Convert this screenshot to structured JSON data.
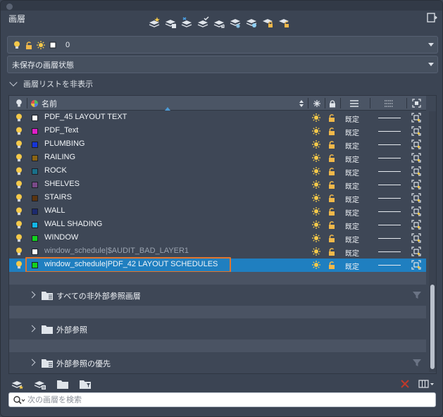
{
  "panel": {
    "title": "画層"
  },
  "top_toolbar": {
    "icons": [
      "new-layer-icon",
      "new-vp-freeze-layer-icon",
      "delete-layer-icon",
      "set-current-icon",
      "layer-states-icon",
      "freeze-vp-icon",
      "isolate-icon",
      "lock-icon",
      "unlock-icon"
    ]
  },
  "current_layer": {
    "value": "0"
  },
  "layer_state": {
    "value": "未保存の画層状態"
  },
  "collapse": {
    "label": "画層リストを非表示"
  },
  "list": {
    "columns": {
      "name": "名前"
    },
    "rows": [
      {
        "name": "PDF_45 LAYOUT TEXT",
        "color": "#ffffff",
        "linetype": "既定",
        "dim": false,
        "selected": false
      },
      {
        "name": "PDF_Text",
        "color": "#e01ec8",
        "linetype": "既定",
        "dim": false,
        "selected": false
      },
      {
        "name": "PLUMBING",
        "color": "#1634d8",
        "linetype": "既定",
        "dim": false,
        "selected": false
      },
      {
        "name": "RAILING",
        "color": "#8a6414",
        "linetype": "既定",
        "dim": false,
        "selected": false
      },
      {
        "name": "ROCK",
        "color": "#19708a",
        "linetype": "既定",
        "dim": false,
        "selected": false
      },
      {
        "name": "SHELVES",
        "color": "#7a4a88",
        "linetype": "既定",
        "dim": false,
        "selected": false
      },
      {
        "name": "STAIRS",
        "color": "#5a3410",
        "linetype": "既定",
        "dim": false,
        "selected": false
      },
      {
        "name": "WALL",
        "color": "#1c2a6e",
        "linetype": "既定",
        "dim": false,
        "selected": false
      },
      {
        "name": "WALL SHADING",
        "color": "#12b6e8",
        "linetype": "既定",
        "dim": false,
        "selected": false
      },
      {
        "name": "WINDOW",
        "color": "#14d21e",
        "linetype": "既定",
        "dim": false,
        "selected": false
      },
      {
        "name": "window_schedule|$AUDIT_BAD_LAYER1",
        "color": "#ffffff",
        "linetype": "既定",
        "dim": true,
        "selected": false
      },
      {
        "name": "window_schedule|PDF_42 LAYOUT SCHEDULES",
        "color": "#14d21e",
        "linetype": "既定",
        "dim": false,
        "selected": true
      }
    ]
  },
  "groups": [
    {
      "label": "すべての非外部参照画層",
      "filter": true
    },
    {
      "label": "外部参照",
      "filter": false
    },
    {
      "label": "外部参照の優先",
      "filter": true
    }
  ],
  "search": {
    "placeholder": "次の画層を検索"
  },
  "colors": {
    "bulb": "#f4c94a",
    "sun": "#f4c94a",
    "lock": "#f0b84a",
    "selection": "#1f7fc0",
    "highlight_box": "#e0752d"
  }
}
